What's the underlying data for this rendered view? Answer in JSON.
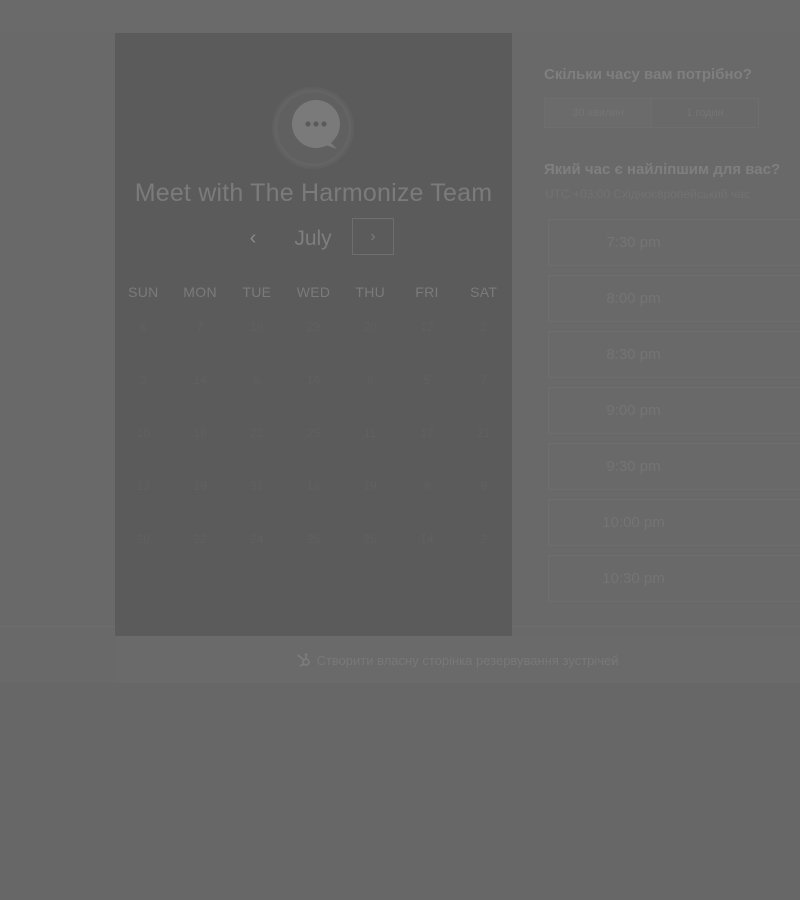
{
  "calendar": {
    "title": "Meet with The Harmonize Team",
    "month": "July",
    "prev_icon": "‹",
    "next_icon": "›",
    "weekdays": [
      "SUN",
      "MON",
      "TUE",
      "WED",
      "THU",
      "FRI",
      "SAT"
    ],
    "weeks": [
      [
        "6",
        "7",
        "18",
        "29",
        "20",
        "12",
        "2"
      ],
      [
        "3",
        "14",
        "5",
        "14",
        "6",
        "5",
        "7"
      ],
      [
        "10",
        "16",
        "22",
        "25",
        "11",
        "17",
        "21"
      ],
      [
        "13",
        "19",
        "31",
        "18",
        "19",
        "8",
        "9"
      ],
      [
        "20",
        "22",
        "24",
        "25",
        "25",
        "14",
        "2"
      ]
    ]
  },
  "duration": {
    "question": "Скільки часу вам потрібно?",
    "options": [
      "30 хвилин",
      "1 годин"
    ]
  },
  "timeslots": {
    "question": "Який час є найліпшим для вас?",
    "timezone": "UTC +03:00 Східноєвропейський час",
    "slots": [
      "7:30 pm",
      "8:00 pm",
      "8:30 pm",
      "9:00 pm",
      "9:30 pm",
      "10:00 pm",
      "10:30 pm"
    ]
  },
  "footer": {
    "text": "Створити власну сторінка резервування зустрічей"
  },
  "icons": {
    "logo": "chat-bubble-logo",
    "footer": "hubspot-sprocket-icon"
  }
}
